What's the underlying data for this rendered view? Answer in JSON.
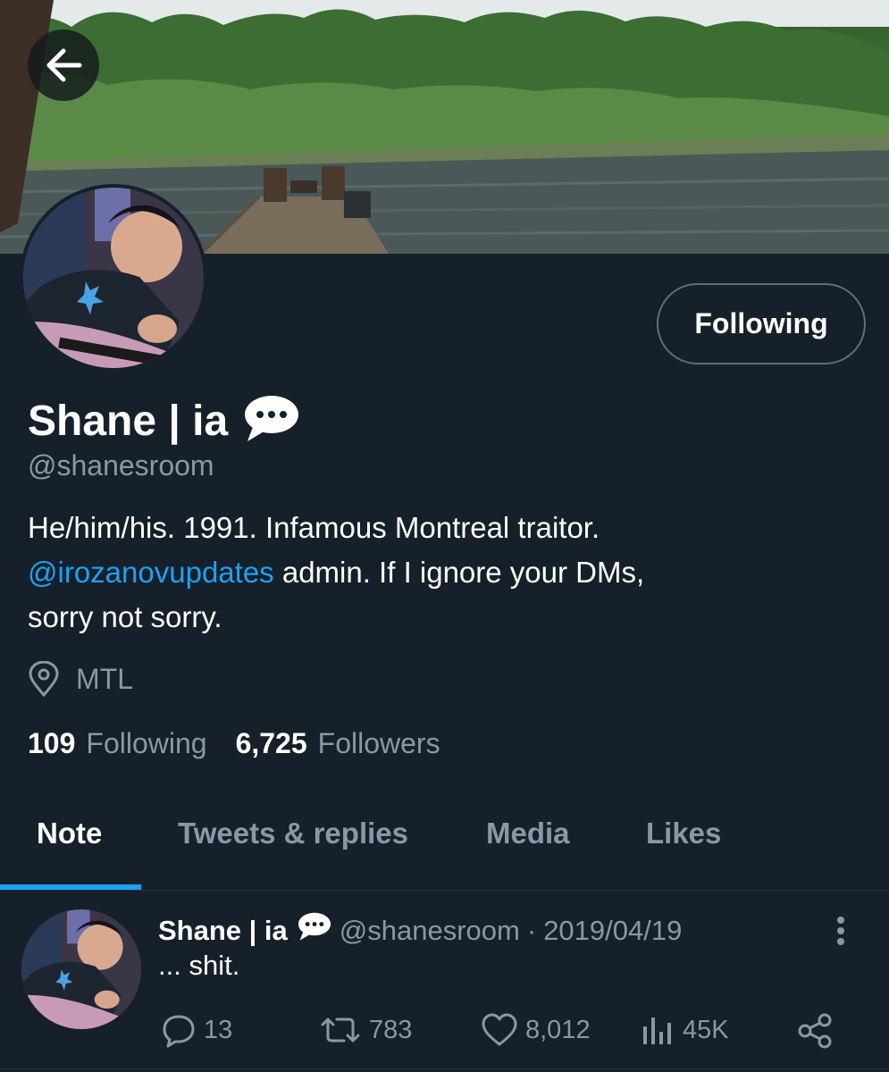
{
  "header": {
    "back_icon": "arrow-left-icon",
    "follow_button_label": "Following"
  },
  "profile": {
    "display_name": "Shane | ia",
    "name_emoji": "speech-balloon-icon",
    "handle": "@shanesroom",
    "bio": {
      "line1": "He/him/his. 1991. Infamous Montreal traitor.",
      "mention": "@irozanovupdates",
      "line2_rest": " admin. If I ignore your DMs,",
      "line3": "sorry not sorry."
    },
    "location_icon": "location-pin-icon",
    "location": "MTL",
    "following_count": "109",
    "following_label": "Following",
    "followers_count": "6,725",
    "followers_label": "Followers"
  },
  "tabs": [
    {
      "label": "Note",
      "active": true
    },
    {
      "label": "Tweets & replies",
      "active": false
    },
    {
      "label": "Media",
      "active": false
    },
    {
      "label": "Likes",
      "active": false
    }
  ],
  "tweet": {
    "author_name": "Shane | ia",
    "author_handle": "@shanesroom",
    "separator": "·",
    "date": "2019/04/19",
    "text": "... shit.",
    "replies": "13",
    "retweets": "783",
    "likes": "8,012",
    "views": "45K"
  },
  "colors": {
    "background": "#15202b",
    "accent": "#1da1f2",
    "secondary_text": "#8899a6"
  }
}
